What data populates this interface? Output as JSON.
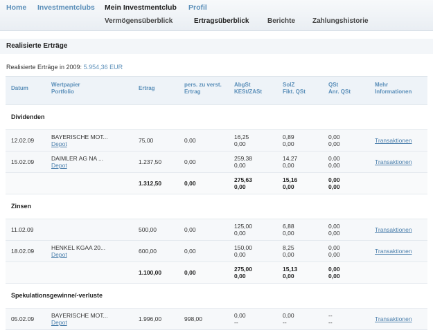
{
  "nav": {
    "top": [
      "Home",
      "Investmentclubs",
      "Mein Investmentclub",
      "Profil"
    ],
    "sub": [
      "Vermögensüberblick",
      "Ertragsüberblick",
      "Berichte",
      "Zahlungshistorie"
    ]
  },
  "page": {
    "title": "Realisierte Erträge",
    "summary_label": "Realisierte Erträge in 2009:",
    "summary_value": "5.954,36 EUR"
  },
  "columns": {
    "datum": "Datum",
    "wp1": "Wertpapier",
    "wp2": "Portfolio",
    "ertrag": "Ertrag",
    "pers1": "pers. zu verst.",
    "pers2": "Ertrag",
    "abg1": "AbgSt",
    "abg2": "KESt/ZASt",
    "solz1": "SolZ",
    "solz2": "Fikt. QSt",
    "qst1": "QSt",
    "qst2": "Anr. QSt",
    "mehr1": "Mehr",
    "mehr2": "Informationen"
  },
  "sections": {
    "div": {
      "title": "Dividenden",
      "r1": {
        "datum": "12.02.09",
        "wp": "BAYERISCHE MOT...",
        "portfolio": "Depot",
        "ertrag": "75,00",
        "pers": "0,00",
        "abg1": "16,25",
        "abg2": "0,00",
        "solz1": "0,89",
        "solz2": "0,00",
        "qst1": "0,00",
        "qst2": "0,00",
        "link": "Transaktionen"
      },
      "r2": {
        "datum": "15.02.09",
        "wp": "DAIMLER AG NA ...",
        "portfolio": "Depot",
        "ertrag": "1.237,50",
        "pers": "0,00",
        "abg1": "259,38",
        "abg2": "0,00",
        "solz1": "14,27",
        "solz2": "0,00",
        "qst1": "0,00",
        "qst2": "0,00",
        "link": "Transaktionen"
      },
      "sum": {
        "ertrag": "1.312,50",
        "pers": "0,00",
        "abg1": "275,63",
        "abg2": "0,00",
        "solz1": "15,16",
        "solz2": "0,00",
        "qst1": "0,00",
        "qst2": "0,00"
      }
    },
    "zins": {
      "title": "Zinsen",
      "r1": {
        "datum": "11.02.09",
        "ertrag": "500,00",
        "pers": "0,00",
        "abg1": "125,00",
        "abg2": "0,00",
        "solz1": "6,88",
        "solz2": "0,00",
        "qst1": "0,00",
        "qst2": "0,00",
        "link": "Transaktionen"
      },
      "r2": {
        "datum": "18.02.09",
        "wp": "HENKEL KGAA 20...",
        "portfolio": "Depot",
        "ertrag": "600,00",
        "pers": "0,00",
        "abg1": "150,00",
        "abg2": "0,00",
        "solz1": "8,25",
        "solz2": "0,00",
        "qst1": "0,00",
        "qst2": "0,00",
        "link": "Transaktionen"
      },
      "sum": {
        "ertrag": "1.100,00",
        "pers": "0,00",
        "abg1": "275,00",
        "abg2": "0,00",
        "solz1": "15,13",
        "solz2": "0,00",
        "qst1": "0,00",
        "qst2": "0,00"
      }
    },
    "spek": {
      "title": "Spekulationsgewinne/-verluste",
      "r1": {
        "datum": "05.02.09",
        "wp": "BAYERISCHE MOT...",
        "portfolio": "Depot",
        "ertrag": "1.996,00",
        "pers": "998,00",
        "abg1": "0,00",
        "abg2": "--",
        "solz1": "0,00",
        "solz2": "--",
        "qst1": "--",
        "qst2": "--",
        "link": "Transaktionen"
      }
    }
  }
}
